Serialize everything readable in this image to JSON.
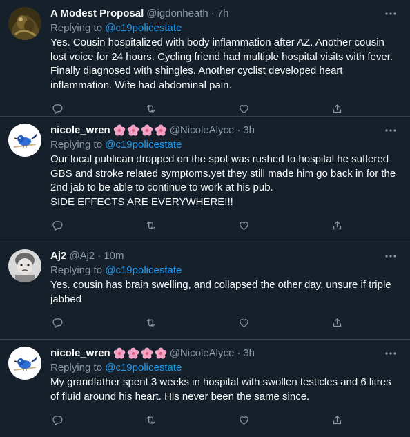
{
  "tweets": [
    {
      "name": "A Modest Proposal",
      "handle": "@igdonheath",
      "time": "7h",
      "reply_prefix": "Replying to",
      "reply_to": "@c19policestate",
      "text": "Yes. Cousin hospitalized with body inflammation after AZ. Another cousin lost voice for 24 hours. Cycling friend had multiple hospital visits with fever. Finally diagnosed with shingles. Another cyclist developed heart inflammation. Wife had abdominal pain.",
      "avatar": "painting-avatar",
      "name_emoji_count": 0
    },
    {
      "name": "nicole_wren",
      "handle": "@NicoleAlyce",
      "time": "3h",
      "reply_prefix": "Replying to",
      "reply_to": "@c19policestate",
      "text": "Our local publican dropped on the spot was rushed to hospital he suffered GBS and stroke related symptoms.yet they still made him go back in for the 2nd jab to be able to continue to work at his pub.\nSIDE EFFECTS ARE EVERYWHERE!!!",
      "avatar": "wren-bird-avatar",
      "name_emoji_count": 4
    },
    {
      "name": "Aj2",
      "handle": "@Aj2",
      "time": "10m",
      "reply_prefix": "Replying to",
      "reply_to": "@c19policestate",
      "text": "Yes. cousin has brain swelling, and collapsed the other day. unsure if triple jabbed",
      "avatar": "child-photo-avatar",
      "name_emoji_count": 0
    },
    {
      "name": "nicole_wren",
      "handle": "@NicoleAlyce",
      "time": "3h",
      "reply_prefix": "Replying to",
      "reply_to": "@c19policestate",
      "text": "My grandfather spent 3 weeks in hospital with swollen testicles and 6 litres of fluid around his heart. His never been the same since.",
      "avatar": "wren-bird-avatar",
      "name_emoji_count": 4
    }
  ],
  "separator": "·",
  "colors": {
    "background": "#15202b",
    "text": "#f7f9f9",
    "muted": "#8b98a5",
    "link": "#1d9bf0",
    "divider": "#38444d"
  },
  "icons": [
    "reply-icon",
    "retweet-icon",
    "like-icon",
    "share-icon",
    "more-options-icon",
    "cherry-blossom-emoji"
  ]
}
